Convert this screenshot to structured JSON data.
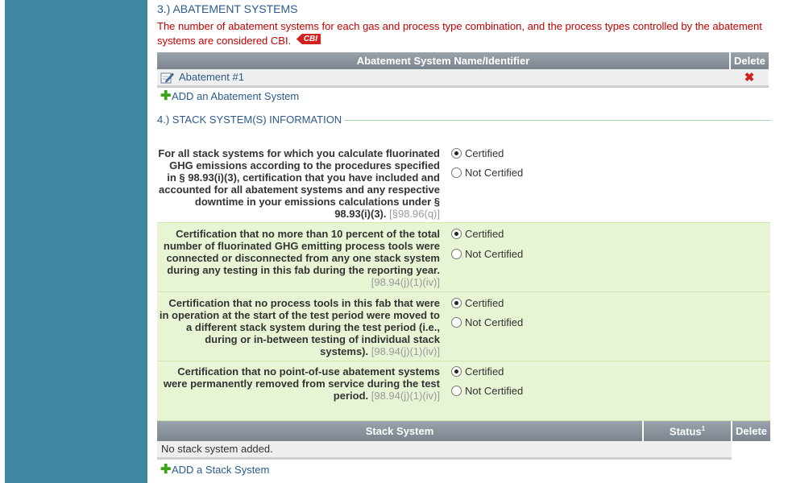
{
  "abatement": {
    "title": "3.) ABATEMENT SYSTEMS",
    "cbi_note": "The number of abatement systems for each gas and process type combination, and the process types controlled by the abatement systems are considered CBI.",
    "cbi_tag": "CBI",
    "table": {
      "headers": [
        "Abatement System Name/Identifier",
        "Delete"
      ],
      "rows": [
        {
          "name": "Abatement #1",
          "delete": "✖"
        }
      ]
    },
    "add_link": "ADD an Abatement System"
  },
  "stack": {
    "title": "4.) STACK SYSTEM(S) INFORMATION",
    "certifications": [
      {
        "text": "For all stack systems for which you calculate fluorinated GHG emissions according to the procedures specified in § 98.93(i)(3), certification that you have included and accounted for all abatement systems and any respective downtime in your emissions calculations under § 98.93(i)(3).",
        "cite": "[§98.96(q)]",
        "options": [
          "Certified",
          "Not Certified"
        ],
        "selected": "Certified"
      },
      {
        "text": "Certification that no more than 10 percent of the total number of fluorinated GHG emitting process tools were connected or disconnected from any one stack system during any testing in this fab during the reporting year.",
        "cite": "[98.94(j)(1)(iv)]",
        "options": [
          "Certified",
          "Not Certified"
        ],
        "selected": "Certified"
      },
      {
        "text": "Certification that no process tools in this fab that were in operation at the start of the test period were moved to a different stack system during the test period (i.e., during or in-between testing of individual stack systems).",
        "cite": "[98.94(j)(1)(iv)]",
        "options": [
          "Certified",
          "Not Certified"
        ],
        "selected": "Certified"
      },
      {
        "text": "Certification that no point-of-use abatement systems were permanently removed from service during the test period.",
        "cite": "[98.94(j)(1)(iv)]",
        "options": [
          "Certified",
          "Not Certified"
        ],
        "selected": "Certified"
      }
    ],
    "table": {
      "headers": [
        "Stack System",
        "Status",
        "Delete"
      ],
      "status_sup": "1",
      "empty_message": "No stack system added."
    },
    "add_link": "ADD a Stack System"
  },
  "colors": {
    "sidebar": "#3e87a3",
    "cbi_red": "#c00000",
    "link_blue": "#2c5a8c",
    "row_green": "#e8f5d4"
  }
}
